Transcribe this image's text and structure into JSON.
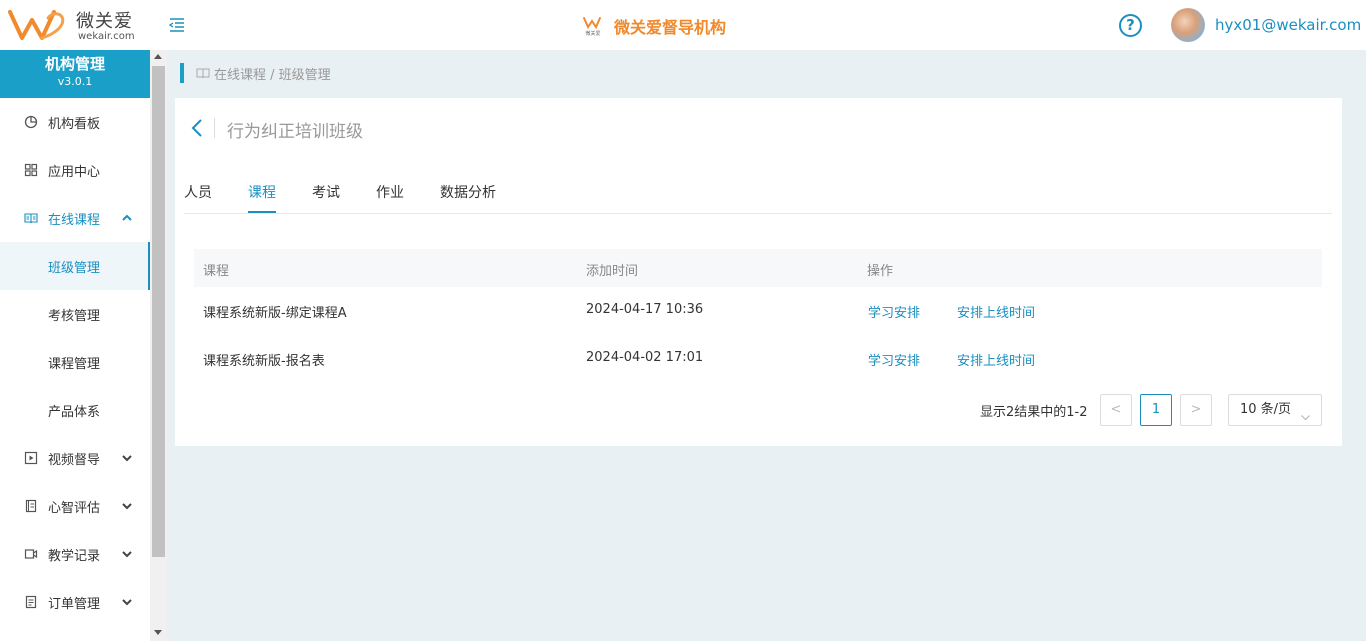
{
  "header": {
    "logo_text": "微关爱",
    "logo_sub": "wekair.com",
    "brand_title": "微关爱督导机构",
    "brand_mark_text": "微关爱",
    "user_email": "hyx01@wekair.com",
    "help_glyph": "?"
  },
  "sidebar": {
    "title": "机构管理",
    "version": "v3.0.1",
    "items": [
      {
        "label": "机构看板",
        "icon": "pie-chart-icon"
      },
      {
        "label": "应用中心",
        "icon": "grid-icon"
      },
      {
        "label": "在线课程",
        "icon": "book-icon",
        "expanded": true
      },
      {
        "label": "班级管理",
        "selected": true
      },
      {
        "label": "考核管理"
      },
      {
        "label": "课程管理"
      },
      {
        "label": "产品体系"
      },
      {
        "label": "视频督导",
        "icon": "video-play-icon"
      },
      {
        "label": "心智评估",
        "icon": "notebook-icon"
      },
      {
        "label": "教学记录",
        "icon": "camera-icon"
      },
      {
        "label": "订单管理",
        "icon": "receipt-icon"
      }
    ]
  },
  "breadcrumb": {
    "text": "在线课程 / 班级管理"
  },
  "page": {
    "title": "行为纠正培训班级",
    "tabs": [
      "人员",
      "课程",
      "考试",
      "作业",
      "数据分析"
    ],
    "active_tab": "课程"
  },
  "table": {
    "columns": [
      "课程",
      "添加时间",
      "操作"
    ],
    "rows": [
      {
        "course": "课程系统新版-绑定课程A",
        "time": "2024-04-17 10:36",
        "action1": "学习安排",
        "action2": "安排上线时间"
      },
      {
        "course": "课程系统新版-报名表",
        "time": "2024-04-02 17:01",
        "action1": "学习安排",
        "action2": "安排上线时间"
      }
    ]
  },
  "pagination": {
    "info": "显示2结果中的1-2",
    "prev": "<",
    "current": "1",
    "next": ">",
    "page_size": "10 条/页"
  },
  "colors": {
    "accent": "#1a8fc0",
    "sidebar_head": "#1a9fc9",
    "brand": "#f08a2c",
    "background": "#e9f0f3"
  }
}
